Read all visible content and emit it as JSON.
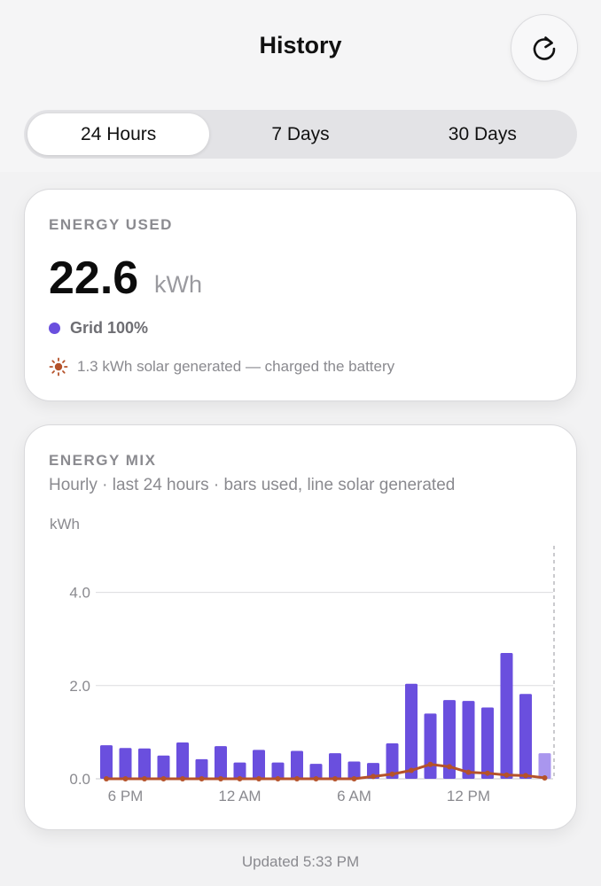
{
  "header": {
    "title": "History",
    "refresh_icon": "refresh-icon"
  },
  "tabs": [
    {
      "label": "24 Hours",
      "active": true
    },
    {
      "label": "7 Days",
      "active": false
    },
    {
      "label": "30 Days",
      "active": false
    }
  ],
  "energy_used": {
    "label": "ENERGY USED",
    "value": "22.6",
    "unit": "kWh",
    "grid_legend": "Grid 100%",
    "grid_color": "#6a4fde",
    "solar_icon": "sun-icon",
    "solar_color": "#b5522a",
    "solar_text": "1.3 kWh solar generated — charged the battery"
  },
  "energy_mix": {
    "label": "ENERGY MIX",
    "subtitle": "Hourly · last 24 hours · bars used, line solar generated"
  },
  "chart_data": {
    "type": "bar",
    "ylabel": "kWh",
    "ylim": [
      0,
      5
    ],
    "yticks": [
      "0.0",
      "2.0",
      "4.0"
    ],
    "ytick_values": [
      0,
      2,
      4
    ],
    "xtick_labels": [
      "6 PM",
      "12 AM",
      "6 AM",
      "12 PM"
    ],
    "xtick_indices": [
      1,
      7,
      13,
      19
    ],
    "bar_color": "#6a4fde",
    "current_bar_color": "#a996ee",
    "line_color": "#b5522a",
    "grid": true,
    "series": [
      {
        "values": [
          0.72,
          0.66,
          0.65,
          0.5,
          0.78,
          0.42,
          0.7,
          0.35,
          0.62,
          0.35,
          0.6,
          0.32,
          0.55,
          0.37,
          0.34,
          0.76,
          2.04,
          1.4,
          1.69,
          1.67,
          1.53,
          2.7,
          1.82,
          0.55
        ]
      },
      {
        "values": [
          0,
          0,
          0,
          0,
          0,
          0,
          0,
          0,
          0,
          0,
          0,
          0,
          0,
          0,
          0.05,
          0.1,
          0.18,
          0.31,
          0.26,
          0.14,
          0.12,
          0.08,
          0.07,
          0.02
        ]
      }
    ]
  },
  "footer": {
    "updated": "Updated 5:33 PM"
  }
}
